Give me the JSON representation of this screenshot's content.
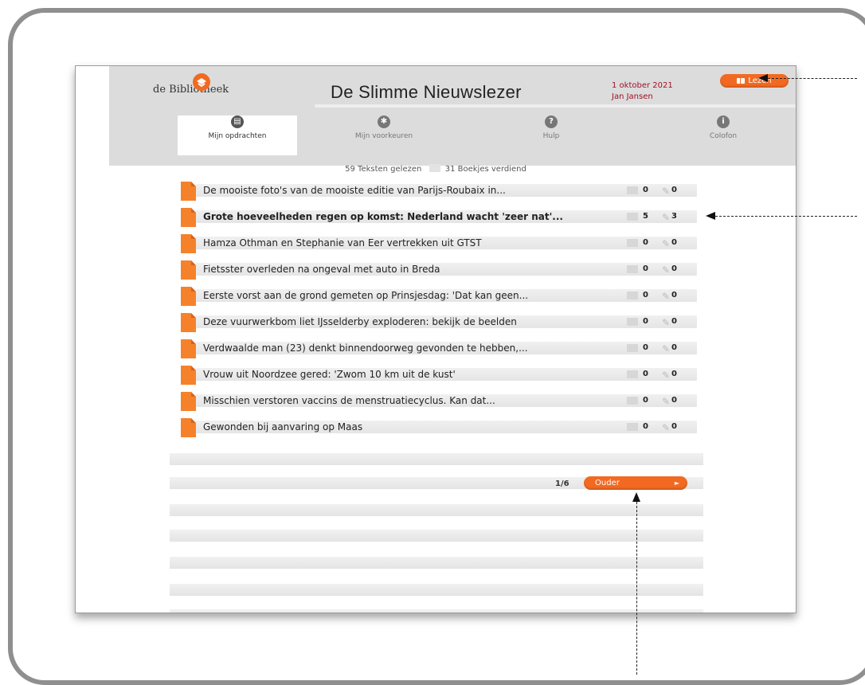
{
  "header": {
    "logo_text": "de Bibliotheek",
    "app_title": "De Slimme Nieuwslezer",
    "date": "1 oktober 2021",
    "user": "Jan Jansen",
    "read_button": "Lezen"
  },
  "nav": {
    "items": [
      {
        "label": "Mijn opdrachten",
        "icon": "book-icon",
        "glyph": "▤"
      },
      {
        "label": "Mijn voorkeuren",
        "icon": "gear-icon",
        "glyph": "✱"
      },
      {
        "label": "Hulp",
        "icon": "help-icon",
        "glyph": "?"
      },
      {
        "label": "Colofon",
        "icon": "info-icon",
        "glyph": "i"
      }
    ]
  },
  "stats": {
    "texts_read": "59 Teksten gelezen",
    "booklets_earned": "31 Boekjes verdiend"
  },
  "articles": [
    {
      "title": "De mooiste foto's van de mooiste editie van Parijs-Roubaix in...",
      "read": "0",
      "written": "0",
      "bold": false
    },
    {
      "title": "Grote hoeveelheden regen op komst: Nederland wacht 'zeer nat'...",
      "read": "5",
      "written": "3",
      "bold": true
    },
    {
      "title": "Hamza Othman en Stephanie van Eer vertrekken uit GTST",
      "read": "0",
      "written": "0",
      "bold": false
    },
    {
      "title": "Fietsster overleden na ongeval met auto in Breda",
      "read": "0",
      "written": "0",
      "bold": false
    },
    {
      "title": "Eerste vorst aan de grond gemeten op Prinsjesdag: 'Dat kan geen...",
      "read": "0",
      "written": "0",
      "bold": false
    },
    {
      "title": "Deze vuurwerkbom liet IJsselderby exploderen: bekijk de beelden",
      "read": "0",
      "written": "0",
      "bold": false
    },
    {
      "title": "Verdwaalde man (23) denkt binnendoorweg gevonden te hebben,...",
      "read": "0",
      "written": "0",
      "bold": false
    },
    {
      "title": "Vrouw uit Noordzee gered: 'Zwom 10 km uit de kust'",
      "read": "0",
      "written": "0",
      "bold": false
    },
    {
      "title": "Misschien verstoren vaccins de menstruatiecyclus. Kan dat...",
      "read": "0",
      "written": "0",
      "bold": false
    },
    {
      "title": "Gewonden bij aanvaring op Maas",
      "read": "0",
      "written": "0",
      "bold": false
    }
  ],
  "pagination": {
    "page": "1/6",
    "older_button": "Ouder",
    "arrow": "►"
  },
  "colors": {
    "accent": "#f26a22",
    "date_color": "#a01024",
    "header_bg": "#dcdcdc"
  }
}
